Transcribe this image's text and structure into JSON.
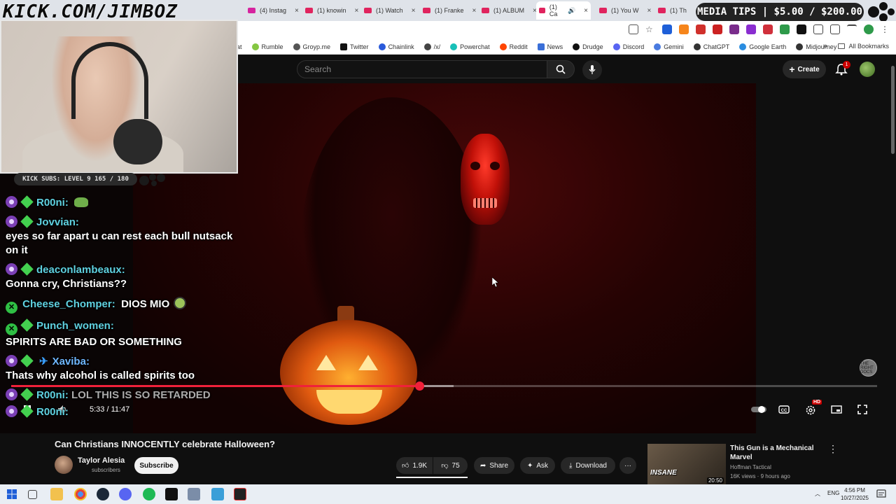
{
  "site_watermark": "KICK.COM/JIMBOZ",
  "media_tips": "MEDIA TIPS | $5.00 / $200.00",
  "tabs": [
    {
      "label": "(4) Instag",
      "active": false
    },
    {
      "label": "(1) knowin",
      "active": false
    },
    {
      "label": "(1) Watch",
      "active": false
    },
    {
      "label": "(1) Franke",
      "active": false
    },
    {
      "label": "(1) ALBUM",
      "active": false
    },
    {
      "label": "(1) Ca",
      "active": true
    },
    {
      "label": "(1) You W",
      "active": false
    },
    {
      "label": "(1) Th",
      "active": false
    }
  ],
  "bookmarks": [
    {
      "label": "at",
      "color": "#888"
    },
    {
      "label": "Rumble",
      "color": "#85c742"
    },
    {
      "label": "Groyp.me",
      "color": "#555"
    },
    {
      "label": "Twitter",
      "color": "#111"
    },
    {
      "label": "Chainlink",
      "color": "#2a5ada"
    },
    {
      "label": "/x/",
      "color": "#444"
    },
    {
      "label": "Powerchat",
      "color": "#18c0b8"
    },
    {
      "label": "Reddit",
      "color": "#ff4500"
    },
    {
      "label": "News",
      "color": "#3a6fd8"
    },
    {
      "label": "Drudge",
      "color": "#111"
    },
    {
      "label": "Discord",
      "color": "#5865f2"
    },
    {
      "label": "Gemini",
      "color": "#4a7be0"
    },
    {
      "label": "ChatGPT",
      "color": "#333"
    },
    {
      "label": "Google Earth",
      "color": "#2a8de0"
    },
    {
      "label": "Midjourney",
      "color": "#333"
    }
  ],
  "all_bookmarks": "All Bookmarks",
  "yt_header": {
    "search_placeholder": "Search",
    "create_label": "Create",
    "notification_count": "1"
  },
  "overlay": {
    "kick_subs": "KICK SUBS: LEVEL 9 165 / 180"
  },
  "chat": [
    {
      "user": "R00ni:",
      "text": "",
      "badges": [
        "round",
        "diamond"
      ],
      "color": "cyan",
      "emote": "frog",
      "inline": true
    },
    {
      "user": "Jovvian:",
      "text": "eyes so far apart u can rest each bull nutsack on it",
      "badges": [
        "round",
        "diamond"
      ],
      "color": "cyan",
      "inline": false
    },
    {
      "user": "deaconlambeaux:",
      "text": "Gonna cry, Christians??",
      "badges": [
        "round",
        "diamond"
      ],
      "color": "cyan",
      "inline": false
    },
    {
      "user": "Cheese_Chomper:",
      "text": "DIOS MIO",
      "badges": [
        "green"
      ],
      "color": "cyan",
      "emote": "alien",
      "inline": true
    },
    {
      "user": "Punch_women:",
      "text": "SPIRITS ARE BAD OR SOMETHING",
      "badges": [
        "green",
        "diamond"
      ],
      "color": "cyan",
      "inline": false
    },
    {
      "user": "Xaviba:",
      "text": "Thats why alcohol is called spirits too",
      "badges": [
        "round",
        "diamond",
        "sword"
      ],
      "color": "blue",
      "inline": false
    },
    {
      "user": "R00ni:",
      "text": "LOL THIS IS SO RETARDED",
      "badges": [
        "round",
        "diamond"
      ],
      "color": "cyan",
      "inline": true
    },
    {
      "user": "R00ni:",
      "text": "",
      "badges": [
        "round",
        "diamond"
      ],
      "color": "cyan",
      "inline": true
    }
  ],
  "player": {
    "time": "5:33 / 11:47",
    "progress_fraction": 0.471,
    "buffered_fraction": 0.511,
    "hd_badge": "HD",
    "channel_watermark": "THE RIGHT DOCS"
  },
  "video": {
    "title": "Can Christians INNOCENTLY celebrate Halloween?",
    "channel": "Taylor Alesia",
    "subscribers": "subscribers",
    "subscribe_label": "Subscribe",
    "likes": "1.9K",
    "dislikes": "75",
    "share_label": "Share",
    "ask_label": "Ask",
    "download_label": "Download"
  },
  "recommended": {
    "title": "This Gun is a Mechanical Marvel",
    "channel": "Hoffman Tactical",
    "meta": "16K views · 9 hours ago",
    "duration": "20:50",
    "thumb_text": "INSANE"
  },
  "taskbar": {
    "lang": "ENG",
    "time": "4:56 PM",
    "date": "10/27/2025"
  },
  "colors": {
    "accent": "#f0213a",
    "yt_bg": "#0f0f0f",
    "chat_cyan": "#5fd1e0"
  }
}
